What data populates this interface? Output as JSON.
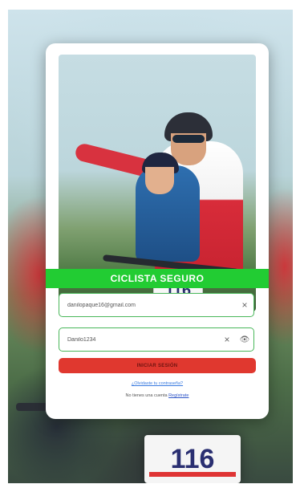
{
  "app": {
    "title": "CICLISTA SEGURO",
    "accent_color": "#22cc33",
    "danger_color": "#e0382f"
  },
  "background": {
    "bib_number": "116"
  },
  "hero": {
    "bib_number": "116"
  },
  "form": {
    "email_value": "danilopaque16@gmail.com",
    "password_value": "Danilo1234",
    "clear_icon": "×",
    "eye_icon": "👁",
    "login_label": "INICIAR SESIÓN",
    "forgot_label": "¿Olvidaste tu contraseña?",
    "no_account_text": "No tienes una cuenta",
    "register_label": "Regístrate"
  }
}
